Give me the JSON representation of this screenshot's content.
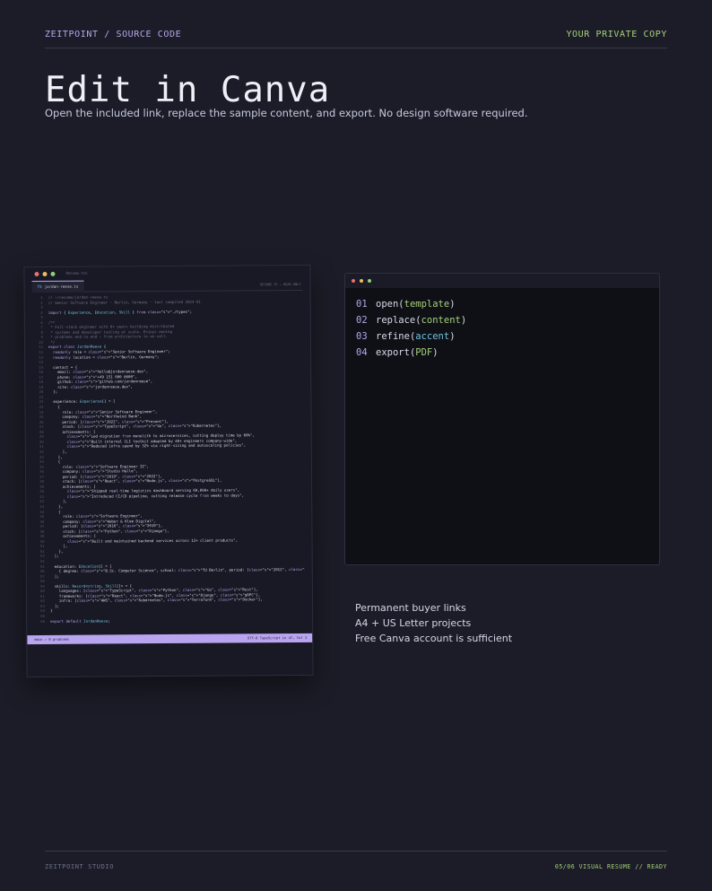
{
  "header": {
    "brand": "ZEITPOINT / SOURCE CODE",
    "copy_label": "YOUR PRIVATE COPY"
  },
  "hero": {
    "title": "Edit in Canva",
    "subtitle": "Open the included link, replace the sample content, and export. No design software required."
  },
  "editor": {
    "window_title": "Resume.tsx",
    "tab_label": "jordan-reese.ts",
    "status_top_right": "RESUME.TS — READ ONLY",
    "statusbar_left": "main   ✓ 0 problems",
    "statusbar_right": "UTF-8    TypeScript    Ln 47, Col 1",
    "code_lines": [
      "// ~/resume/jordan-reese.ts",
      "// Senior Software Engineer · Berlin, Germany · last compiled 2024-01",
      "",
      "import { Experience, Education, Skill } from \"./types\";",
      "",
      "/**",
      " * Full-stack engineer with 8+ years building distributed",
      " * systems and developer tooling at scale. Enjoys owning",
      " * problems end-to-end — from architecture to on-call.",
      " */",
      "export class JordanReese {",
      "  readonly role = \"Senior Software Engineer\";",
      "  readonly location = \"Berlin, Germany\";",
      "",
      "  contact = {",
      "    email: \"hello@jordanreese.dev\",",
      "    phone: \"+49 151 000 0000\",",
      "    github: \"github.com/jordanreese\",",
      "    site: \"jordanreese.dev\",",
      "  };",
      "",
      "  experience: Experience[] = [",
      "    {",
      "      role: \"Senior Software Engineer\",",
      "      company: \"Northwind Bank\",",
      "      period: [\"2022\", \"Present\"],",
      "      stack: [\"TypeScript\", \"Go\", \"Kubernetes\"],",
      "      achievements: [",
      "        \"Led migration from monolith to microservices, cutting deploy time by 60%\",",
      "        \"Built internal CLI toolkit adopted by 40+ engineers company-wide\",",
      "        \"Reduced infra spend by 32% via right-sizing and autoscaling policies\",",
      "      ],",
      "    },",
      "    {",
      "      role: \"Software Engineer II\",",
      "      company: \"Studio Halle\",",
      "      period: [\"2019\", \"2022\"],",
      "      stack: [\"React\", \"Node.js\", \"PostgreSQL\"],",
      "      achievements: [",
      "        \"Shipped real-time logistics dashboard serving 60,000+ daily users\",",
      "        \"Introduced CI/CD pipeline, cutting release cycle from weeks to days\",",
      "      ],",
      "    },",
      "    {",
      "      role: \"Software Engineer\",",
      "      company: \"Weber & Klee Digital\",",
      "      period: [\"2016\", \"2019\"],",
      "      stack: [\"Python\", \"Django\"],",
      "      achievements: [",
      "        \"Built and maintained backend services across 12+ client products\",",
      "      ],",
      "    },",
      "  ];",
      "",
      "  education: Education[] = [",
      "    { degree: \"B.Sc. Computer Science\", school: \"TU Berlin\", period: [\"2012\", \"2016\"] },",
      "  ];",
      "",
      "  skills: Record<string, Skill[]> = {",
      "    languages: [\"TypeScript\", \"Python\", \"Go\", \"Rust\"],",
      "    frameworks: [\"React\", \"Node.js\", \"Django\", \"gRPC\"],",
      "    infra: [\"AWS\", \"Kubernetes\", \"Terraform\", \"Docker\"],",
      "  };",
      "}",
      "",
      "export default JordanReese;"
    ]
  },
  "terminal": {
    "commands": [
      {
        "num": "01",
        "fn": "open",
        "arg": "template"
      },
      {
        "num": "02",
        "fn": "replace",
        "arg": "content"
      },
      {
        "num": "03",
        "fn": "refine",
        "arg": "accent"
      },
      {
        "num": "04",
        "fn": "export",
        "arg": "PDF"
      }
    ]
  },
  "features": [
    "Permanent buyer links",
    "A4 + US Letter projects",
    "Free Canva account is sufficient"
  ],
  "footer": {
    "studio": "ZEITPOINT STUDIO",
    "right": "05/06  VISUAL RESUME  //  READY"
  }
}
